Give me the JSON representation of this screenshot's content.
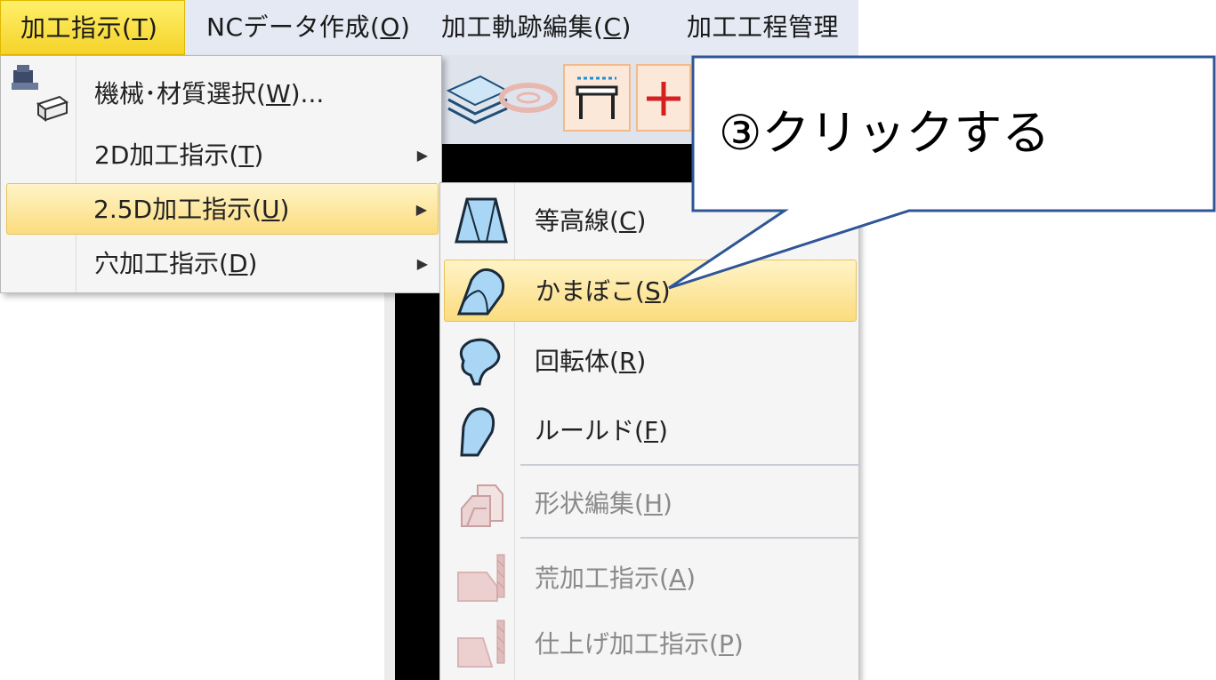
{
  "menubar": {
    "items": [
      {
        "label": "加工指示(",
        "key": "T",
        "suffix": ")"
      },
      {
        "label": "NCデータ作成(",
        "key": "O",
        "suffix": ")"
      },
      {
        "label": "加工軌跡編集(",
        "key": "C",
        "suffix": ")"
      },
      {
        "label": "加工工程管理",
        "key": "",
        "suffix": ""
      }
    ]
  },
  "menu": {
    "items": [
      {
        "label": "機械･材質選択(",
        "key": "W",
        "suffix": ")..."
      },
      {
        "label": "2D加工指示(",
        "key": "T",
        "suffix": ")",
        "arrow": "▶"
      },
      {
        "label": "2.5D加工指示(",
        "key": "U",
        "suffix": ")",
        "arrow": "▶"
      },
      {
        "label": "穴加工指示(",
        "key": "D",
        "suffix": ")",
        "arrow": "▶"
      }
    ]
  },
  "submenu": {
    "items": [
      {
        "label": "等高線(",
        "key": "C",
        "suffix": ")"
      },
      {
        "label": "かまぼこ(",
        "key": "S",
        "suffix": ")"
      },
      {
        "label": "回転体(",
        "key": "R",
        "suffix": ")"
      },
      {
        "label": "ルールド(",
        "key": "F",
        "suffix": ")"
      },
      {
        "label": "形状編集(",
        "key": "H",
        "suffix": ")"
      },
      {
        "label": "荒加工指示(",
        "key": "A",
        "suffix": ")"
      },
      {
        "label": "仕上げ加工指示(",
        "key": "P",
        "suffix": ")"
      }
    ]
  },
  "callout": {
    "text": "③クリックする"
  },
  "colors": {
    "menubar_bg": "#e4e9f3",
    "active_menu": "#f5d32a",
    "highlight": "#fbdc7e",
    "callout_border": "#2f5597",
    "icon_blue": "#9fd0f0"
  }
}
